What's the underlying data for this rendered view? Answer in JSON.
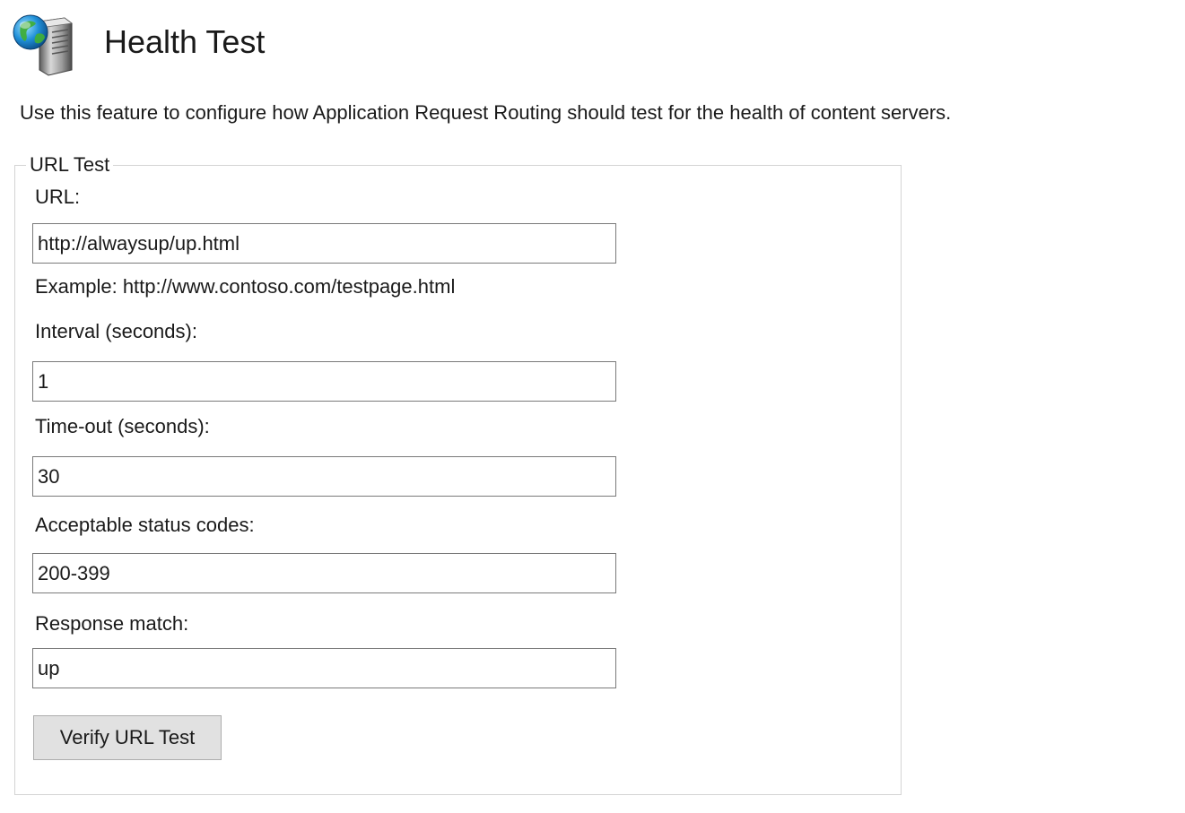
{
  "header": {
    "icon": "globe-server-icon",
    "title": "Health Test"
  },
  "description": "Use this feature to configure how Application Request Routing should test for the health of content servers.",
  "url_test": {
    "legend": "URL Test",
    "url": {
      "label": "URL:",
      "value": "http://alwaysup/up.html",
      "example": "Example: http://www.contoso.com/testpage.html"
    },
    "interval": {
      "label": "Interval (seconds):",
      "value": "1"
    },
    "timeout": {
      "label": "Time-out (seconds):",
      "value": "30"
    },
    "status_codes": {
      "label": "Acceptable status codes:",
      "value": "200-399"
    },
    "response_match": {
      "label": "Response match:",
      "value": "up"
    },
    "verify_button_label": "Verify URL Test"
  },
  "colors": {
    "background": "#ffffff",
    "text": "#1a1a1a",
    "input_border": "#7a7a7a",
    "group_border": "#d4d4d4",
    "button_face": "#e1e1e1",
    "button_border": "#adadad"
  }
}
